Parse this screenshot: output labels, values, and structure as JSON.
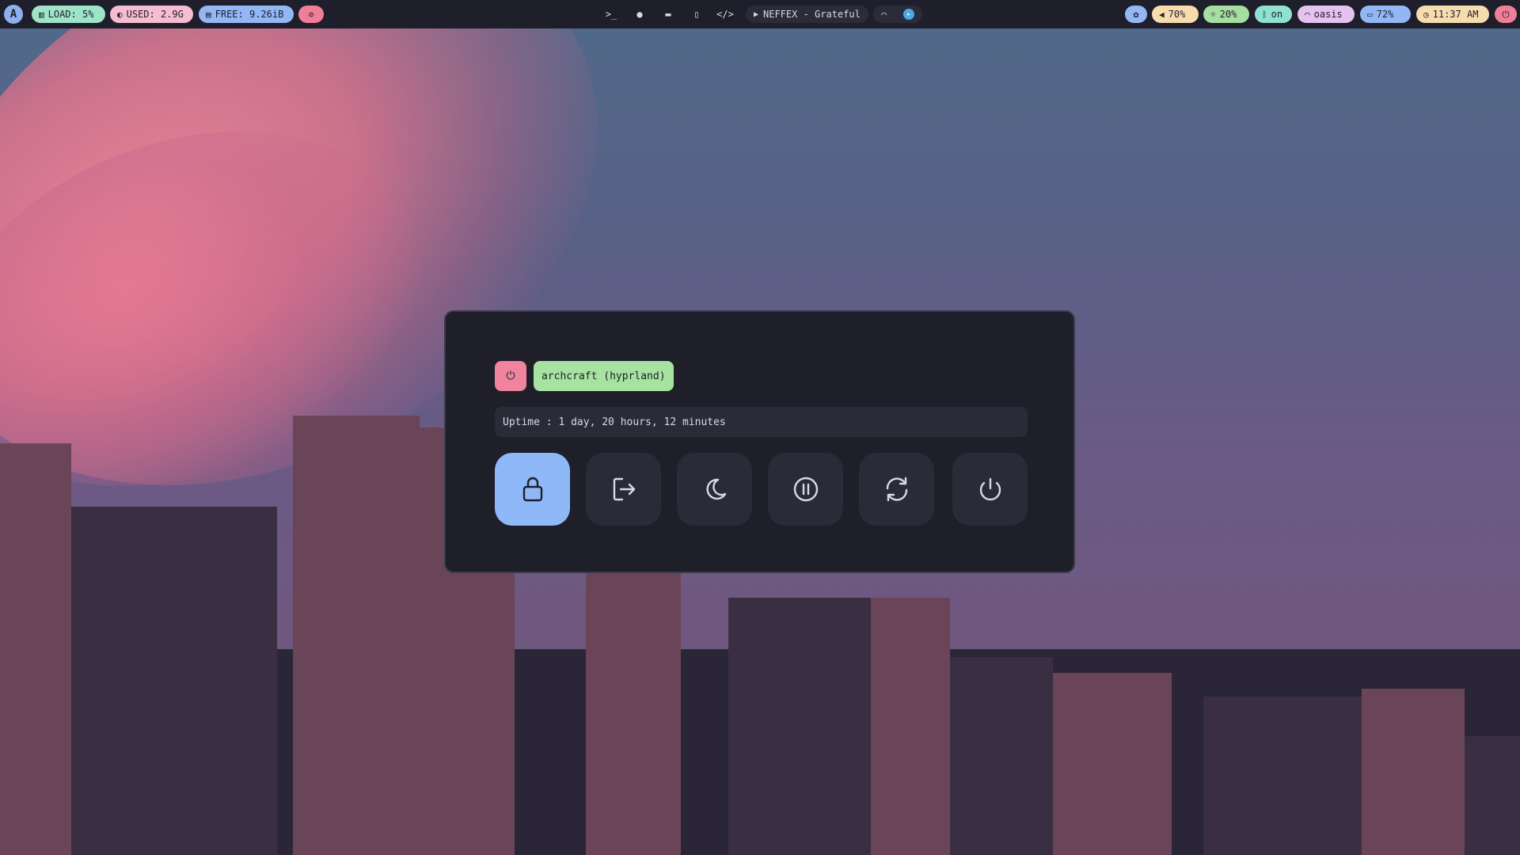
{
  "colors": {
    "bar_bg": "#1e1f2b",
    "dialog_bg": "#1f1f2a",
    "accent_blue": "#8fb8f8",
    "accent_red": "#f0839d",
    "accent_green": "#a6e3a1"
  },
  "topbar": {
    "left": {
      "load": {
        "icon": "chart-icon",
        "label": "LOAD: 5%"
      },
      "used": {
        "icon": "memory-icon",
        "label": "USED: 2.9G"
      },
      "free": {
        "icon": "disk-icon",
        "label": "FREE: 9.26iB"
      },
      "privacy": {
        "icon": "eye-off-icon"
      }
    },
    "center": {
      "launchers": [
        "terminal-icon",
        "firefox-icon",
        "folder-icon",
        "document-icon",
        "code-icon"
      ],
      "media": {
        "icon": "play-icon",
        "label": "NEFFEX - Grateful"
      },
      "tray": [
        "wifi-icon",
        "telegram-icon"
      ]
    },
    "right": {
      "palette": {
        "icon": "palette-icon"
      },
      "volume": {
        "icon": "volume-icon",
        "label": "70%"
      },
      "brightness": {
        "icon": "brightness-icon",
        "label": "20%"
      },
      "bluetooth": {
        "icon": "bluetooth-icon",
        "label": "on"
      },
      "network": {
        "icon": "wifi-icon",
        "label": "oasis"
      },
      "battery": {
        "icon": "battery-icon",
        "label": "72%"
      },
      "clock": {
        "icon": "clock-icon",
        "label": "11:37 AM"
      },
      "power": {
        "icon": "power-icon"
      }
    }
  },
  "dialog": {
    "host_label": "archcraft (hyprland)",
    "uptime": "Uptime : 1 day, 20 hours, 12 minutes",
    "actions": [
      {
        "name": "lock",
        "icon": "lock-icon",
        "active": true
      },
      {
        "name": "logout",
        "icon": "logout-icon",
        "active": false
      },
      {
        "name": "suspend",
        "icon": "moon-icon",
        "active": false
      },
      {
        "name": "hibernate",
        "icon": "pause-icon",
        "active": false
      },
      {
        "name": "reboot",
        "icon": "refresh-icon",
        "active": false
      },
      {
        "name": "shutdown",
        "icon": "power-icon",
        "active": false
      }
    ]
  }
}
